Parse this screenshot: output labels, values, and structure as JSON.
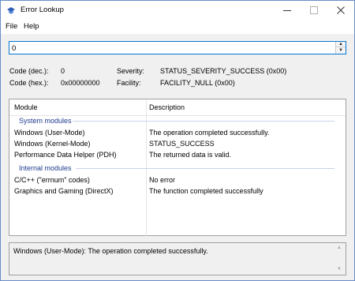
{
  "window": {
    "title": "Error Lookup",
    "icon": "app-icon",
    "controls": {
      "minimize": "minimize-icon",
      "maximize": "maximize-icon",
      "close": "close-icon"
    }
  },
  "menu": {
    "file": "File",
    "help": "Help"
  },
  "input": {
    "value": "0"
  },
  "info": {
    "code_dec_label": "Code (dec.):",
    "code_dec_value": "0",
    "code_hex_label": "Code (hex.):",
    "code_hex_value": "0x00000000",
    "severity_label": "Severity:",
    "severity_value": "STATUS_SEVERITY_SUCCESS (0x00)",
    "facility_label": "Facility:",
    "facility_value": "FACILITY_NULL (0x00)"
  },
  "table": {
    "columns": [
      "Module",
      "Description"
    ],
    "groups": [
      {
        "name": "System modules",
        "rows": [
          {
            "module": "Windows (User-Mode)",
            "description": "The operation completed successfully."
          },
          {
            "module": "Windows (Kernel-Mode)",
            "description": "STATUS_SUCCESS"
          },
          {
            "module": "Performance Data Helper (PDH)",
            "description": "The returned data is valid."
          }
        ]
      },
      {
        "name": "Internal modules",
        "rows": [
          {
            "module": "C/C++ (\"errnum\" codes)",
            "description": "No error"
          },
          {
            "module": "Graphics and Gaming (DirectX)",
            "description": "The function completed successfully"
          }
        ]
      }
    ]
  },
  "status": {
    "text": "Windows (User-Mode): The operation completed successfully."
  }
}
